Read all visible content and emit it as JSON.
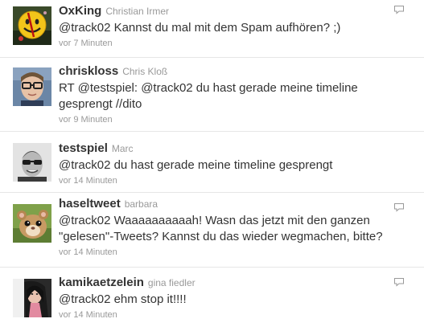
{
  "tweets": [
    {
      "screen_name": "OxKing",
      "full_name": "Christian Irmer",
      "text": "@track02 Kannst du mal mit dem Spam aufhören? ;)",
      "time": "vor 7 Minuten",
      "avatar": "smiley-avatar",
      "has_reply": true
    },
    {
      "screen_name": "chriskloss",
      "full_name": "Chris Kloß",
      "text": "RT @testspiel: @track02 du hast gerade meine timeline gesprengt //dito",
      "time": "vor 9 Minuten",
      "avatar": "man-with-glasses-avatar",
      "has_reply": false
    },
    {
      "screen_name": "testspiel",
      "full_name": "Marc",
      "text": "@track02 du hast gerade meine timeline gesprengt",
      "time": "vor 14 Minuten",
      "avatar": "man-with-sunglasses-avatar",
      "has_reply": false
    },
    {
      "screen_name": "haseltweet",
      "full_name": "barbara",
      "text": "@track02 Waaaaaaaaaah! Wasn das jetzt mit den ganzen \"gelesen\"-Tweets? Kannst du das wieder wegmachen, bitte?",
      "time": "vor 14 Minuten",
      "avatar": "hamster-avatar",
      "has_reply": true
    },
    {
      "screen_name": "kamikaetzelein",
      "full_name": "gina fiedler",
      "text": "@track02 ehm stop it!!!!",
      "time": "vor 14 Minuten",
      "avatar": "woman-avatar",
      "has_reply": true
    }
  ]
}
